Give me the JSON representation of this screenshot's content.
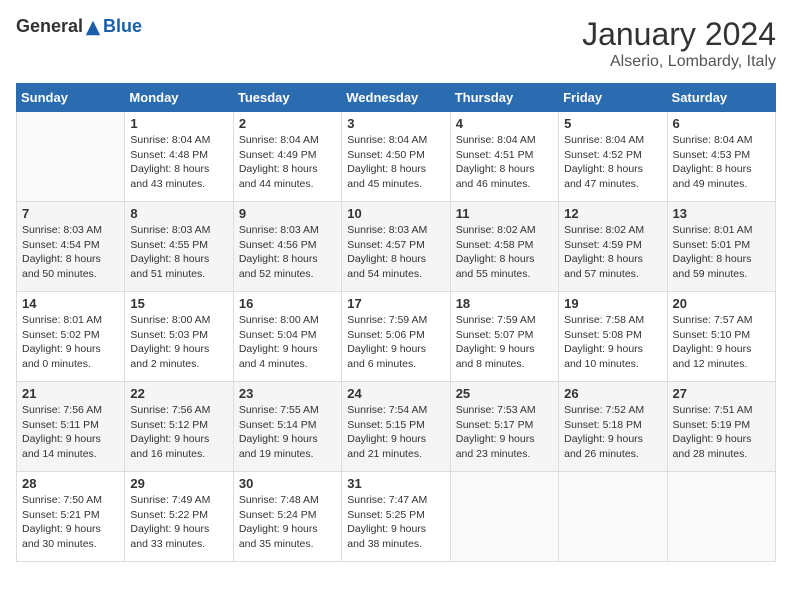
{
  "header": {
    "logo_general": "General",
    "logo_blue": "Blue",
    "month": "January 2024",
    "location": "Alserio, Lombardy, Italy"
  },
  "weekdays": [
    "Sunday",
    "Monday",
    "Tuesday",
    "Wednesday",
    "Thursday",
    "Friday",
    "Saturday"
  ],
  "weeks": [
    [
      {
        "day": "",
        "sunrise": "",
        "sunset": "",
        "daylight": ""
      },
      {
        "day": "1",
        "sunrise": "8:04 AM",
        "sunset": "4:48 PM",
        "daylight": "8 hours and 43 minutes."
      },
      {
        "day": "2",
        "sunrise": "8:04 AM",
        "sunset": "4:49 PM",
        "daylight": "8 hours and 44 minutes."
      },
      {
        "day": "3",
        "sunrise": "8:04 AM",
        "sunset": "4:50 PM",
        "daylight": "8 hours and 45 minutes."
      },
      {
        "day": "4",
        "sunrise": "8:04 AM",
        "sunset": "4:51 PM",
        "daylight": "8 hours and 46 minutes."
      },
      {
        "day": "5",
        "sunrise": "8:04 AM",
        "sunset": "4:52 PM",
        "daylight": "8 hours and 47 minutes."
      },
      {
        "day": "6",
        "sunrise": "8:04 AM",
        "sunset": "4:53 PM",
        "daylight": "8 hours and 49 minutes."
      }
    ],
    [
      {
        "day": "7",
        "sunrise": "8:03 AM",
        "sunset": "4:54 PM",
        "daylight": "8 hours and 50 minutes."
      },
      {
        "day": "8",
        "sunrise": "8:03 AM",
        "sunset": "4:55 PM",
        "daylight": "8 hours and 51 minutes."
      },
      {
        "day": "9",
        "sunrise": "8:03 AM",
        "sunset": "4:56 PM",
        "daylight": "8 hours and 52 minutes."
      },
      {
        "day": "10",
        "sunrise": "8:03 AM",
        "sunset": "4:57 PM",
        "daylight": "8 hours and 54 minutes."
      },
      {
        "day": "11",
        "sunrise": "8:02 AM",
        "sunset": "4:58 PM",
        "daylight": "8 hours and 55 minutes."
      },
      {
        "day": "12",
        "sunrise": "8:02 AM",
        "sunset": "4:59 PM",
        "daylight": "8 hours and 57 minutes."
      },
      {
        "day": "13",
        "sunrise": "8:01 AM",
        "sunset": "5:01 PM",
        "daylight": "8 hours and 59 minutes."
      }
    ],
    [
      {
        "day": "14",
        "sunrise": "8:01 AM",
        "sunset": "5:02 PM",
        "daylight": "9 hours and 0 minutes."
      },
      {
        "day": "15",
        "sunrise": "8:00 AM",
        "sunset": "5:03 PM",
        "daylight": "9 hours and 2 minutes."
      },
      {
        "day": "16",
        "sunrise": "8:00 AM",
        "sunset": "5:04 PM",
        "daylight": "9 hours and 4 minutes."
      },
      {
        "day": "17",
        "sunrise": "7:59 AM",
        "sunset": "5:06 PM",
        "daylight": "9 hours and 6 minutes."
      },
      {
        "day": "18",
        "sunrise": "7:59 AM",
        "sunset": "5:07 PM",
        "daylight": "9 hours and 8 minutes."
      },
      {
        "day": "19",
        "sunrise": "7:58 AM",
        "sunset": "5:08 PM",
        "daylight": "9 hours and 10 minutes."
      },
      {
        "day": "20",
        "sunrise": "7:57 AM",
        "sunset": "5:10 PM",
        "daylight": "9 hours and 12 minutes."
      }
    ],
    [
      {
        "day": "21",
        "sunrise": "7:56 AM",
        "sunset": "5:11 PM",
        "daylight": "9 hours and 14 minutes."
      },
      {
        "day": "22",
        "sunrise": "7:56 AM",
        "sunset": "5:12 PM",
        "daylight": "9 hours and 16 minutes."
      },
      {
        "day": "23",
        "sunrise": "7:55 AM",
        "sunset": "5:14 PM",
        "daylight": "9 hours and 19 minutes."
      },
      {
        "day": "24",
        "sunrise": "7:54 AM",
        "sunset": "5:15 PM",
        "daylight": "9 hours and 21 minutes."
      },
      {
        "day": "25",
        "sunrise": "7:53 AM",
        "sunset": "5:17 PM",
        "daylight": "9 hours and 23 minutes."
      },
      {
        "day": "26",
        "sunrise": "7:52 AM",
        "sunset": "5:18 PM",
        "daylight": "9 hours and 26 minutes."
      },
      {
        "day": "27",
        "sunrise": "7:51 AM",
        "sunset": "5:19 PM",
        "daylight": "9 hours and 28 minutes."
      }
    ],
    [
      {
        "day": "28",
        "sunrise": "7:50 AM",
        "sunset": "5:21 PM",
        "daylight": "9 hours and 30 minutes."
      },
      {
        "day": "29",
        "sunrise": "7:49 AM",
        "sunset": "5:22 PM",
        "daylight": "9 hours and 33 minutes."
      },
      {
        "day": "30",
        "sunrise": "7:48 AM",
        "sunset": "5:24 PM",
        "daylight": "9 hours and 35 minutes."
      },
      {
        "day": "31",
        "sunrise": "7:47 AM",
        "sunset": "5:25 PM",
        "daylight": "9 hours and 38 minutes."
      },
      {
        "day": "",
        "sunrise": "",
        "sunset": "",
        "daylight": ""
      },
      {
        "day": "",
        "sunrise": "",
        "sunset": "",
        "daylight": ""
      },
      {
        "day": "",
        "sunrise": "",
        "sunset": "",
        "daylight": ""
      }
    ]
  ]
}
